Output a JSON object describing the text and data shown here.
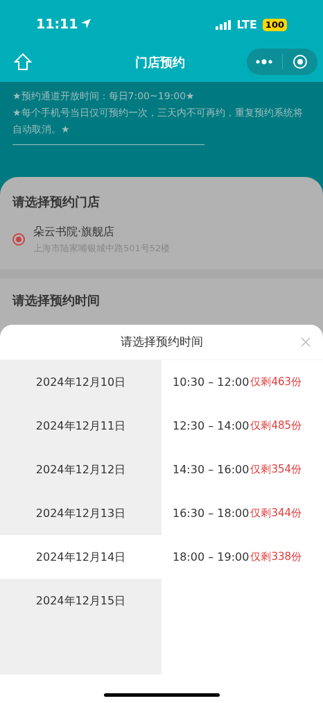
{
  "status_bar": {
    "time": "11:11",
    "network": "LTE",
    "battery": "100"
  },
  "nav": {
    "title": "门店预约"
  },
  "notices": [
    "★预约通道开放时间：每日7:00~19:00★",
    "★每个手机号当日仅可预约一次，三天内不可再约，重复预约系统将自动取消。★"
  ],
  "store_section": {
    "title": "请选择预约门店",
    "stores": [
      {
        "name": "朵云书院·旗舰店",
        "address": "上海市陆家嘴银城中路501号52楼",
        "selected": true
      }
    ]
  },
  "time_section": {
    "title": "请选择预约时间"
  },
  "sheet": {
    "title": "请选择预约时间",
    "dates": [
      {
        "label": "2024年12月10日",
        "selected": false
      },
      {
        "label": "2024年12月11日",
        "selected": false
      },
      {
        "label": "2024年12月12日",
        "selected": false
      },
      {
        "label": "2024年12月13日",
        "selected": false
      },
      {
        "label": "2024年12月14日",
        "selected": true
      },
      {
        "label": "2024年12月15日",
        "selected": false
      }
    ],
    "slots": [
      {
        "time": "10:30 – 12:00",
        "remaining": "仅剩463份"
      },
      {
        "time": "12:30 – 14:00",
        "remaining": "仅剩485份"
      },
      {
        "time": "14:30 – 16:00",
        "remaining": "仅剩354份"
      },
      {
        "time": "16:30 – 18:00",
        "remaining": "仅剩344份"
      },
      {
        "time": "18:00 – 19:00",
        "remaining": "仅剩338份"
      }
    ]
  }
}
